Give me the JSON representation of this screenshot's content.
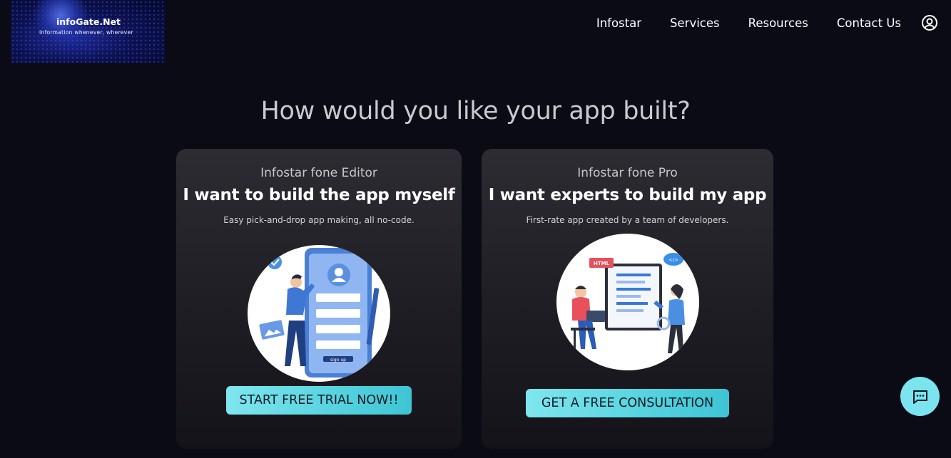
{
  "logo": {
    "name": "infoGate.Net",
    "tagline": "Information whenever, wherever"
  },
  "nav": {
    "items": [
      "Infostar",
      "Services",
      "Resources",
      "Contact Us"
    ],
    "account_icon": "account-circle-icon"
  },
  "heading": "How would you like your app built?",
  "cards": [
    {
      "subtitle": "Infostar fone Editor",
      "title": "I want to build the app myself",
      "description": "Easy pick-and-drop app making, all no-code.",
      "illustration_button": "sign up",
      "cta": "START FREE TRIAL NOW!!"
    },
    {
      "subtitle": "Infostar fone Pro",
      "title": "I want experts to build my app",
      "description": "First-rate app created by a team of developers.",
      "illustration_badge": "HTML",
      "illustration_code": "</>",
      "cta": "GET A FREE CONSULTATION"
    }
  ],
  "chat": {
    "icon": "chat-bubble-icon"
  },
  "colors": {
    "background": "#0b0b16",
    "accent": "#55d3df",
    "card": "#2d2c32"
  }
}
